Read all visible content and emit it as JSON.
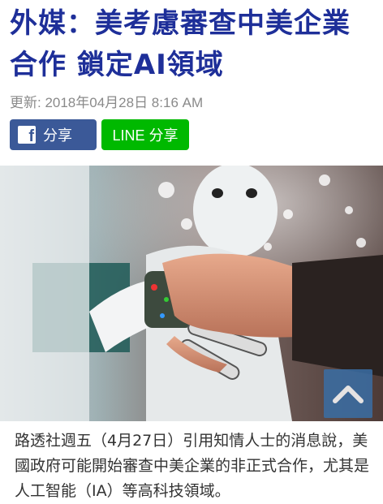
{
  "article": {
    "title": "外媒：美考慮審查中美企業合作 鎖定AI領域",
    "updated": "更新: 2018年04月28日 8:16 AM",
    "body": "路透社週五（4月27日）引用知情人士的消息說，美國政府可能開始審查中美企業的非正式合作，尤其是人工智能（IA）等高科技領域。"
  },
  "share": {
    "facebook_label": "分享",
    "line_label": "LINE 分享"
  },
  "icons": {
    "facebook": "facebook-icon",
    "scroll_top": "chevron-up-icon"
  },
  "colors": {
    "title": "#1e2f99",
    "facebook": "#3b5998",
    "line": "#00b900",
    "scroll_top": "#3a6ea5"
  }
}
